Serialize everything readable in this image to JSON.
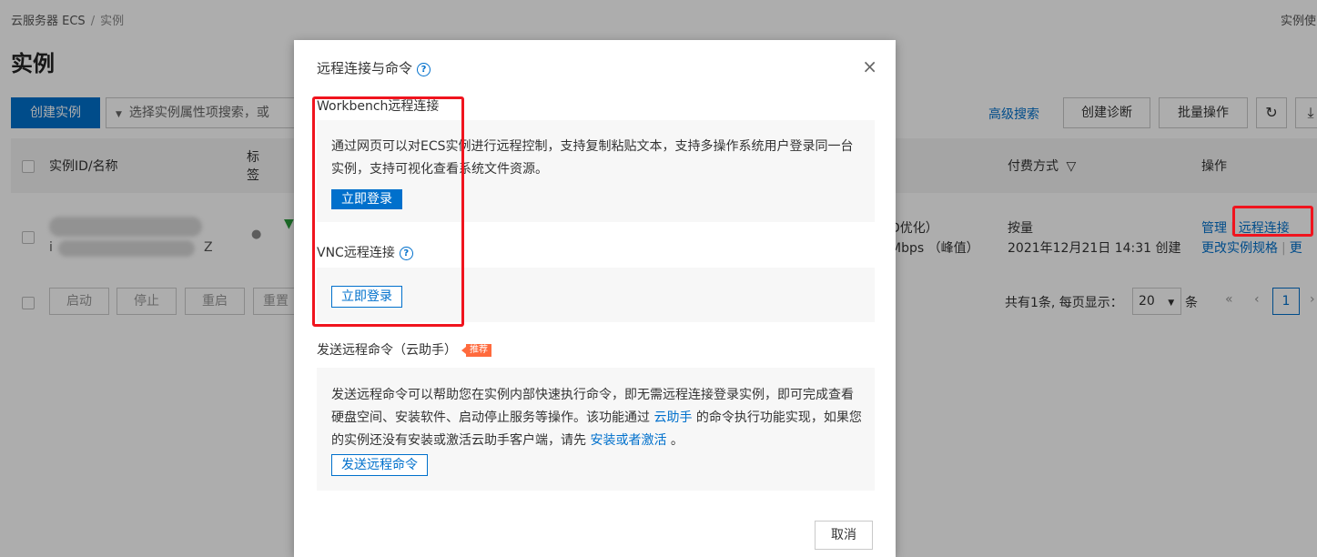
{
  "breadcrumb": {
    "root": "云服务器 ECS",
    "separator": "/",
    "current": "实例"
  },
  "top_right_text": "实例使",
  "page_title": "实例",
  "toolbar": {
    "create_label": "创建实例",
    "search_placeholder": "选择实例属性项搜索，或",
    "advanced_search": "高级搜索",
    "create_diagnosis": "创建诊断",
    "batch_ops": "批量操作",
    "refresh_icon": "↻",
    "download_icon": "⤓"
  },
  "table": {
    "headers": {
      "id": "实例ID/名称",
      "tag_line1": "标",
      "tag_line2": "签",
      "billing": "付费方式",
      "billing_icon": "▽",
      "ops": "操作"
    },
    "row": {
      "id_suffix": "Z",
      "id_prefix": "i",
      "network_line1": "D优化）",
      "network_line2": "Mbps （峰值）",
      "billing_line1": "按量",
      "billing_line2": "2021年12月21日 14:31 创建",
      "op_manage": "管理",
      "op_remote": "远程连接",
      "op_change_spec": "更改实例规格",
      "op_more": "更"
    }
  },
  "footer": {
    "start": "启动",
    "stop": "停止",
    "restart": "重启",
    "reset": "重置",
    "summary": "共有1条, 每页显示：",
    "page_size": "20",
    "page_size_caret": "▼",
    "unit": "条",
    "first": "«",
    "prev": "‹",
    "page": "1",
    "next": "›"
  },
  "modal": {
    "title": "远程连接与命令",
    "help_icon": "?",
    "close_icon": "×",
    "workbench": {
      "title": "Workbench远程连接",
      "desc": "通过网页可以对ECS实例进行远程控制，支持复制粘贴文本，支持多操作系统用户登录同一台实例，支持可视化查看系统文件资源。",
      "button": "立即登录"
    },
    "vnc": {
      "title": "VNC远程连接",
      "button": "立即登录"
    },
    "command": {
      "title": "发送远程命令（云助手）",
      "badge": "推荐",
      "desc_part1": "发送远程命令可以帮助您在实例内部快速执行命令，即无需远程连接登录实例，即可完成查看硬盘空间、安装软件、启动停止服务等操作。该功能通过 ",
      "desc_link1": "云助手",
      "desc_part2": " 的命令执行功能实现，如果您的实例还没有安装或激活云助手客户端，请先 ",
      "desc_link2": "安装或者激活",
      "desc_part3": " 。",
      "button": "发送远程命令"
    },
    "cancel": "取消"
  },
  "colors": {
    "accent": "#0070cc",
    "highlight": "#f0141e",
    "badge": "#ff6a3d"
  }
}
